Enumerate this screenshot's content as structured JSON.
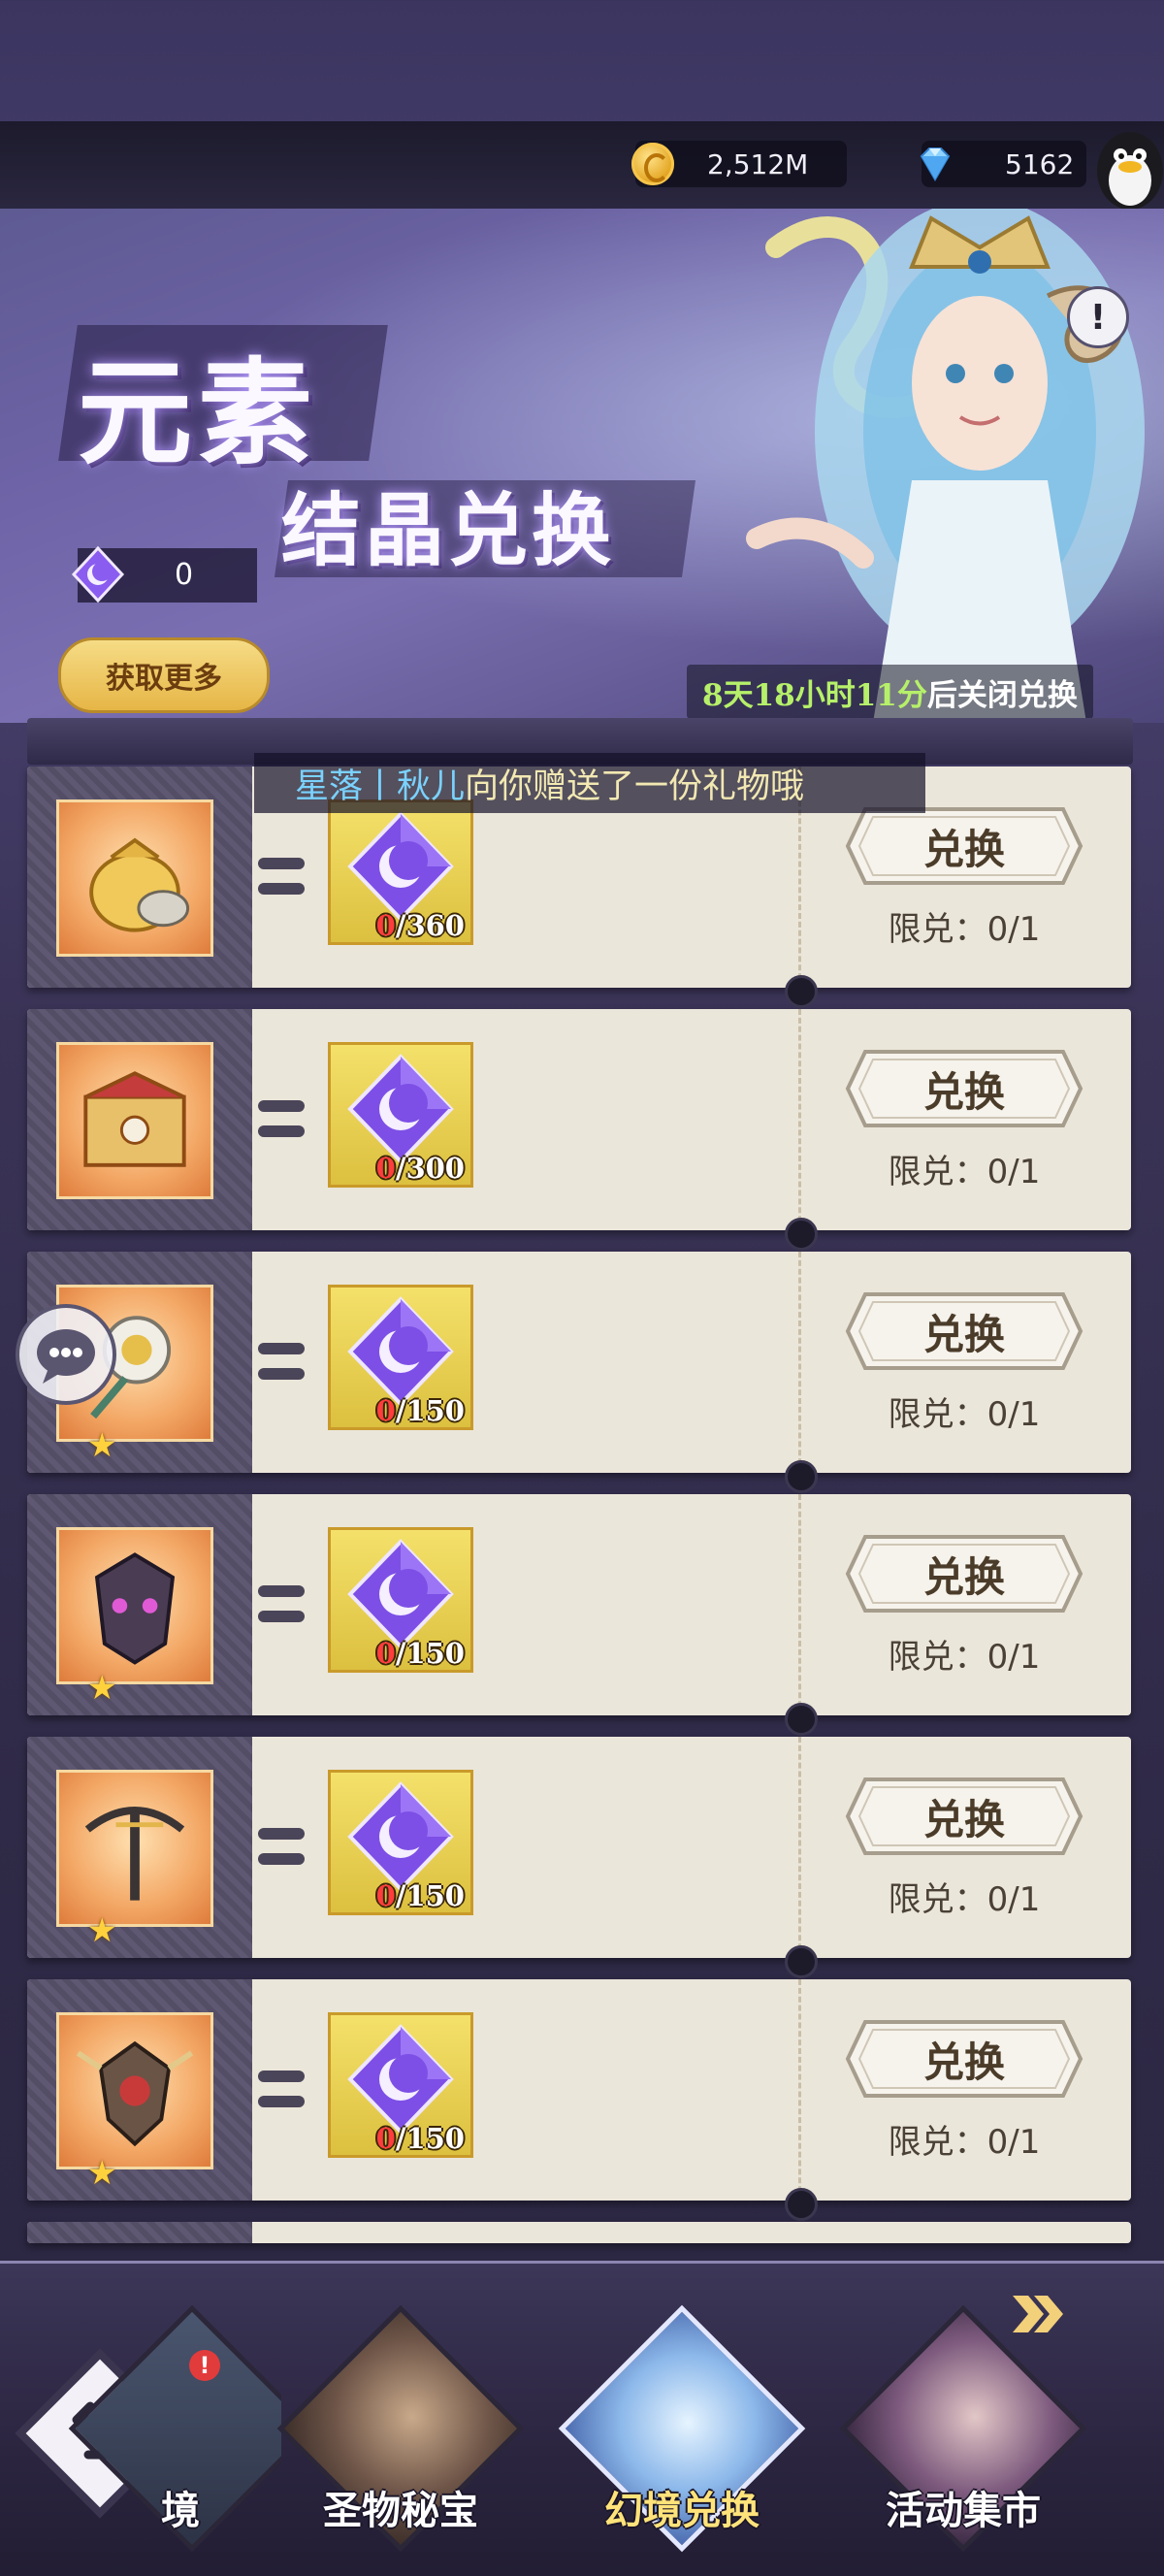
{
  "currency": {
    "gold": "2,512M",
    "diamond": "5162"
  },
  "banner": {
    "title_line1": "元素",
    "title_line2": "结晶兑换",
    "crystal_owned": "0",
    "get_more": "获取更多",
    "info": "!",
    "countdown_time": "8天18小时11分",
    "countdown_suffix": "后关闭兑换"
  },
  "gift_message": {
    "sender": "星落丨秋儿",
    "text": "向你赠送了一份礼物哦"
  },
  "exchange_items": [
    {
      "item": "gold-pouch-icon",
      "cost_owned": "0",
      "cost_required": "/360",
      "button": "兑换",
      "limit": "限兑：0/1",
      "star": ""
    },
    {
      "item": "treasure-chest-icon",
      "cost_owned": "0",
      "cost_required": "/300",
      "button": "兑换",
      "limit": "限兑：0/1",
      "star": ""
    },
    {
      "item": "sun-staff-icon",
      "cost_owned": "0",
      "cost_required": "/150",
      "button": "兑换",
      "limit": "限兑：0/1",
      "star": "★"
    },
    {
      "item": "demon-mask-icon",
      "cost_owned": "0",
      "cost_required": "/150",
      "button": "兑换",
      "limit": "限兑：0/1",
      "star": "★"
    },
    {
      "item": "crossbow-icon",
      "cost_owned": "0",
      "cost_required": "/150",
      "button": "兑换",
      "limit": "限兑：0/1",
      "star": "★"
    },
    {
      "item": "winged-shield-icon",
      "cost_owned": "0",
      "cost_required": "/150",
      "button": "兑换",
      "limit": "限兑：0/1",
      "star": "★"
    }
  ],
  "bottom_nav": {
    "tabs": [
      {
        "label": "境",
        "active": false
      },
      {
        "label": "圣物秘宝",
        "active": false
      },
      {
        "label": "幻境兑换",
        "active": true
      },
      {
        "label": "活动集市",
        "active": false
      }
    ],
    "badge": "!"
  },
  "colors": {
    "accent_gold": "#f6dc86",
    "countdown_highlight": "#b6f06a",
    "gift_sender": "#7ad2ff",
    "active_tab": "#ffe37a"
  }
}
